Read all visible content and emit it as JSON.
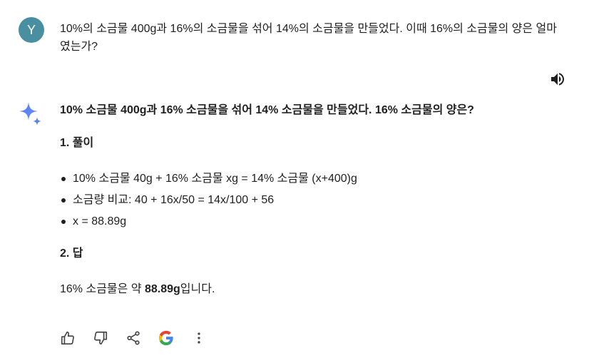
{
  "user": {
    "avatar_letter": "Y",
    "message": "10%의 소금물 400g과 16%의 소금물을 섞어 14%의 소금물을 만들었다. 이때 16%의 소금물의 양은 얼마였는가?"
  },
  "response": {
    "title": "10% 소금물 400g과 16% 소금물을 섞어 14% 소금물을 만들었다. 16% 소금물의 양은?",
    "section1_heading": "1. 풀이",
    "bullets": [
      "10% 소금물 40g + 16% 소금물 xg = 14% 소금물 (x+400)g",
      "소금량 비교: 40 + 16x/50 = 14x/100 + 56",
      "x = 88.89g"
    ],
    "section2_heading": "2. 답",
    "answer_prefix": "16% 소금물은 약 ",
    "answer_value": "88.89g",
    "answer_suffix": "입니다."
  },
  "icons": {
    "avatar_color": "#4a8fa1",
    "speaker": "speaker-icon",
    "sparkle": "gemini-sparkle-icon",
    "actions": [
      "thumbs-up-icon",
      "thumbs-down-icon",
      "share-icon",
      "google-icon",
      "more-vert-icon"
    ]
  }
}
